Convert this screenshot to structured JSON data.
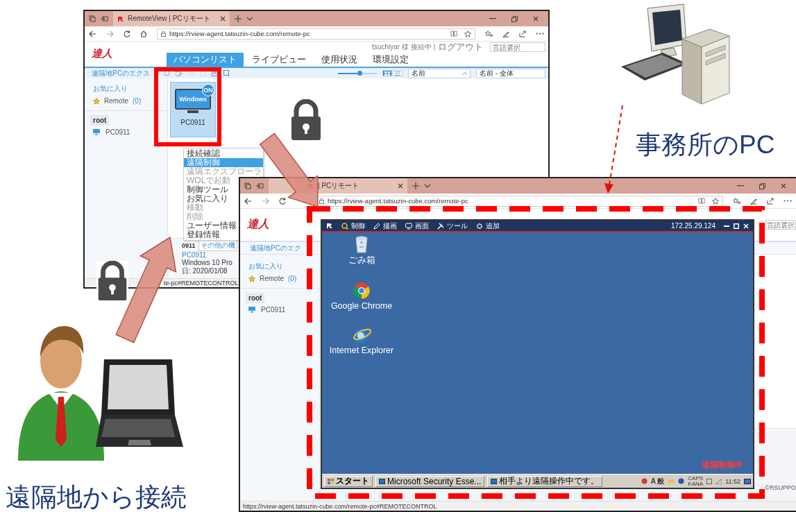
{
  "back_window": {
    "tab_title": "RemoteView | PCリモート",
    "url": "https://rview-agent.tatsuzin-cube.com/remote-pc",
    "logo": "達人",
    "user_status": "tsuchiyar 様 接続中 |",
    "logout_link": "ログアウト",
    "language_field": {
      "placeholder": "言語選択"
    },
    "nav_tabs": [
      {
        "label": "パソコンリスト",
        "selected": true
      },
      {
        "label": "ライブビュー",
        "selected": false
      },
      {
        "label": "使用状況",
        "selected": false
      },
      {
        "label": "環境設定",
        "selected": false
      }
    ],
    "explorer_label": "遠隔地PCのエクス",
    "zoom_slider": {
      "level": 0.55
    },
    "view_modes": [
      {
        "kind": "grid",
        "selected": true
      },
      {
        "kind": "list",
        "selected": false
      }
    ],
    "sort_field": {
      "value": "名前"
    },
    "filter_field": {
      "value": "名前 - 全体"
    },
    "sidebar": {
      "favorites_heading": "お気に入り",
      "favorites": [
        {
          "label": "Remote",
          "count": "(0)"
        }
      ],
      "tree_root": "root",
      "tree_items": [
        {
          "label": "PC0911"
        }
      ]
    },
    "pc_card": {
      "os_label": "Windows",
      "badge": "ON",
      "name": "PC0911",
      "selected": true
    },
    "context_menu": [
      {
        "label": "接続確認",
        "selected": false,
        "disabled": false
      },
      {
        "label": "遠隔制御",
        "selected": true,
        "disabled": false
      },
      {
        "label": "遠隔エクスプローラ",
        "selected": false,
        "disabled": true
      },
      {
        "label": "WOLで起動",
        "selected": false,
        "disabled": true
      },
      {
        "label": "制御ツール",
        "selected": false,
        "disabled": false
      },
      {
        "label": "お気に入り",
        "selected": false,
        "disabled": false
      },
      {
        "label": "移動",
        "selected": false,
        "disabled": true
      },
      {
        "label": "削除",
        "selected": false,
        "disabled": true
      },
      {
        "label": "ユーザー情報",
        "selected": false,
        "disabled": false
      },
      {
        "label": "登録情報",
        "selected": false,
        "disabled": false
      }
    ],
    "details": {
      "name": "0911",
      "more_button": "その他の機",
      "link": "PC0911",
      "os": "Windows 10 Pro",
      "date": "日: 2020/01/08"
    },
    "status_url": "te-pc#REMOTECONTROL"
  },
  "front_window": {
    "tab_title": "| PCリモート",
    "url": "https://rview-agent.tatsuzin-cube.com/remote-pc",
    "logo": "達人",
    "language_field": {
      "placeholder": "言語選択"
    },
    "explorer_label": "遠隔地PCのエク",
    "sidebar": {
      "favorites_heading": "お気に入り",
      "favorites": [
        {
          "label": "Remote",
          "count": "(0)"
        }
      ],
      "tree_root": "root",
      "tree_items": [
        {
          "label": "PC0911"
        }
      ]
    },
    "copyright": "©RSUPPO",
    "status_url": "https://rview-agent.tatsuzin-cube.com/remote-pc#REMOTECONTROL"
  },
  "remote_viewer": {
    "menu": [
      {
        "kind": "control",
        "label": "制御"
      },
      {
        "kind": "draw",
        "label": "描画"
      },
      {
        "kind": "screen",
        "label": "画面"
      },
      {
        "kind": "tools",
        "label": "ツール"
      },
      {
        "kind": "add",
        "label": "追加"
      }
    ],
    "ip": "172.25.29.124",
    "desktop_icons": [
      {
        "kind": "recycle-bin",
        "label": "ごみ箱"
      },
      {
        "kind": "chrome",
        "label": "Google Chrome"
      },
      {
        "kind": "ie",
        "label": "Internet Explorer"
      }
    ],
    "status_text": "遠隔制御中",
    "taskbar": {
      "start": "スタート",
      "tasks": [
        "Microsoft Security Esse...",
        "相手より遠隔操作中です。"
      ],
      "ime": "A 般",
      "caps": "CAPS",
      "kana": "KANA",
      "clock": "11:52"
    }
  },
  "labels": {
    "office_pc": "事務所のPC",
    "remote_access": "遠隔地から接続"
  }
}
